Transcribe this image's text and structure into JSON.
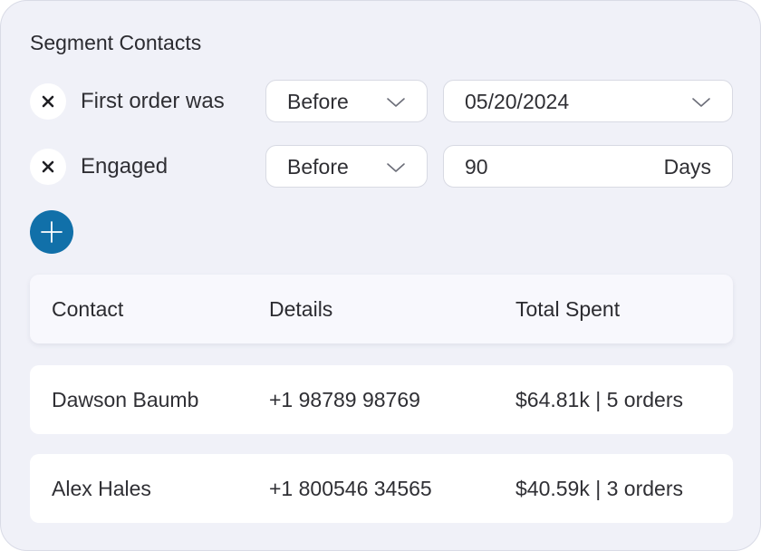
{
  "panel": {
    "title": "Segment Contacts"
  },
  "filters": [
    {
      "label": "First order was",
      "operator": "Before",
      "value": "05/20/2024",
      "value_has_dropdown": true
    },
    {
      "label": "Engaged",
      "operator": "Before",
      "value": "90",
      "unit": "Days"
    }
  ],
  "table": {
    "columns": [
      "Contact",
      "Details",
      "Total Spent"
    ],
    "rows": [
      {
        "contact": "Dawson Baumb",
        "details": "+1 98789 98769",
        "total_spent": "$64.81k | 5 orders"
      },
      {
        "contact": "Alex Hales",
        "details": "+1 800546 34565",
        "total_spent": "$40.59k | 3 orders"
      }
    ]
  },
  "icons": {
    "remove": "close-icon",
    "dropdown": "chevron-down-icon",
    "add": "plus-icon"
  },
  "colors": {
    "panel_background": "#f0f1f8",
    "add_button": "#1170a9"
  }
}
